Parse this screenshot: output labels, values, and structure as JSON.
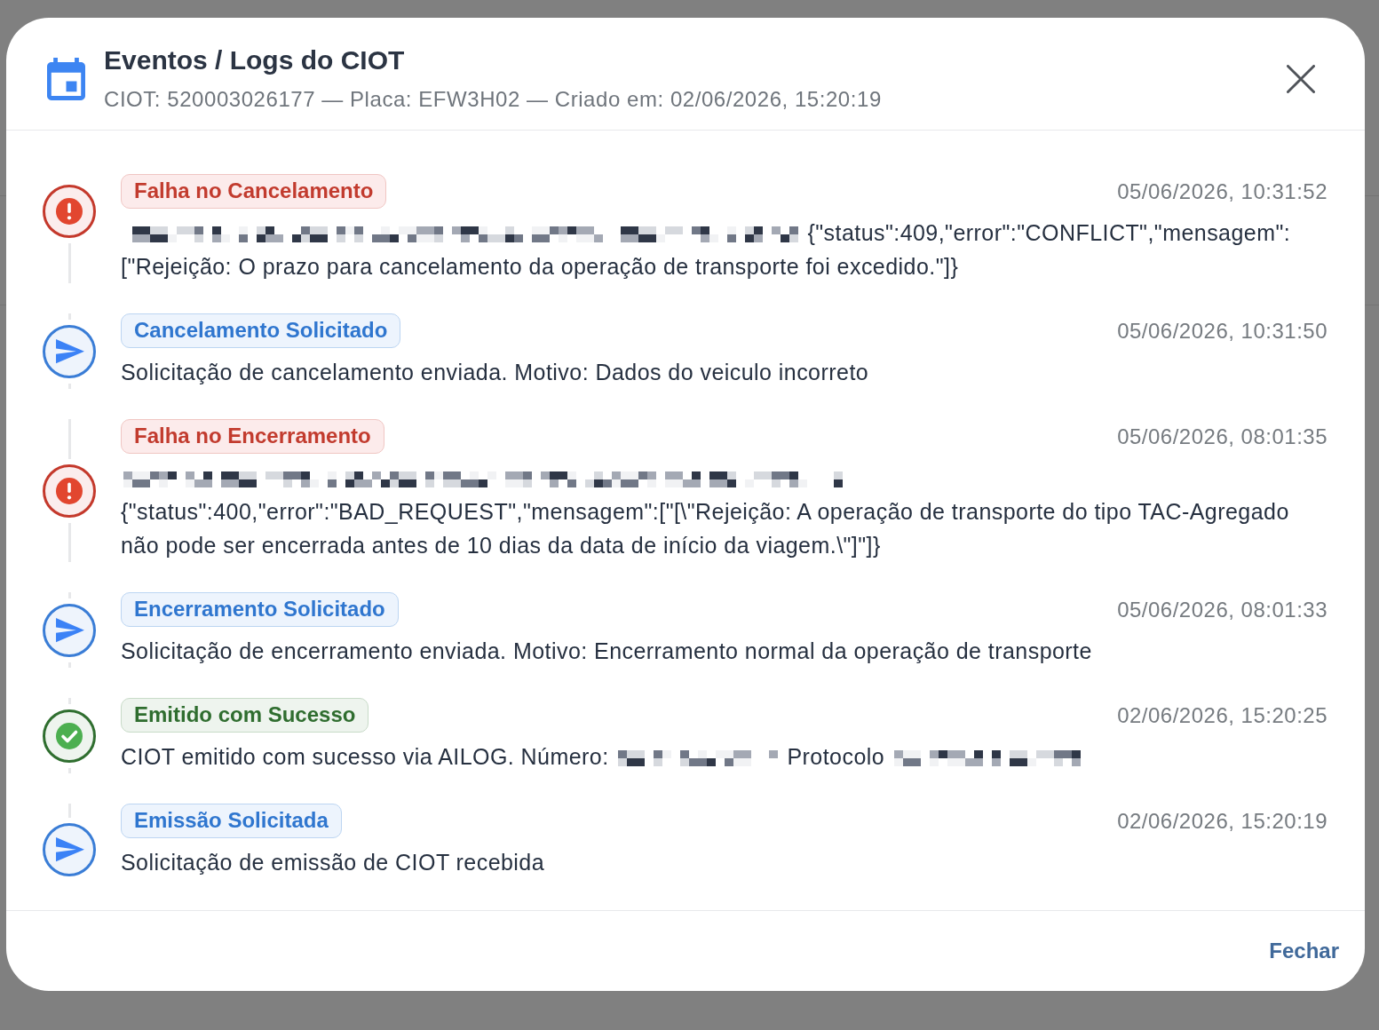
{
  "dialog": {
    "title": "Eventos / Logs do CIOT",
    "subtitle": "CIOT: 520003026177 — Placa: EFW3H02 — Criado em: 02/06/2026, 15:20:19"
  },
  "events": [
    {
      "kind": "error",
      "label": "Falha no Cancelamento",
      "timestamp": "05/06/2026, 10:31:52",
      "lines": [
        [
          {
            "kind": "redacted"
          },
          {
            "kind": "text",
            "text": "{\"status\":409,\"error\":\"CONFLICT\",\"mensagem\":"
          }
        ],
        [
          {
            "kind": "text",
            "text": "[\"Rejeição: O prazo para cancelamento da operação de transporte foi excedido.\"]}"
          }
        ]
      ]
    },
    {
      "kind": "request",
      "label": "Cancelamento Solicitado",
      "timestamp": "05/06/2026, 10:31:50",
      "lines": [
        [
          {
            "kind": "text",
            "text": "Solicitação de cancelamento enviada. Motivo: Dados do veiculo incorreto"
          }
        ]
      ]
    },
    {
      "kind": "error",
      "label": "Falha no Encerramento",
      "timestamp": "05/06/2026, 08:01:35",
      "lines": [
        [
          {
            "kind": "redacted"
          }
        ],
        [
          {
            "kind": "text",
            "text": "{\"status\":400,\"error\":\"BAD_REQUEST\",\"mensagem\":[\"[\\\"Rejeição: A operação de transporte do tipo TAC-Agregado não pode ser encerrada antes de 10 dias da data de início da viagem.\\\"]\"]}"
          }
        ]
      ]
    },
    {
      "kind": "request",
      "label": "Encerramento Solicitado",
      "timestamp": "05/06/2026, 08:01:33",
      "lines": [
        [
          {
            "kind": "text",
            "text": "Solicitação de encerramento enviada. Motivo: Encerramento normal da operação de transporte"
          }
        ]
      ]
    },
    {
      "kind": "success",
      "label": "Emitido com Sucesso",
      "timestamp": "02/06/2026, 15:20:25",
      "lines": [
        [
          {
            "kind": "text",
            "text": "CIOT emitido com sucesso via AILOG. Número:"
          },
          {
            "kind": "redacted"
          },
          {
            "kind": "text",
            "text": "Protocolo"
          },
          {
            "kind": "redacted"
          }
        ]
      ]
    },
    {
      "kind": "request",
      "label": "Emissão Solicitada",
      "timestamp": "02/06/2026, 15:20:19",
      "lines": [
        [
          {
            "kind": "text",
            "text": "Solicitação de emissão de CIOT recebida"
          }
        ]
      ]
    }
  ],
  "footer": {
    "close_button": "Fechar"
  }
}
